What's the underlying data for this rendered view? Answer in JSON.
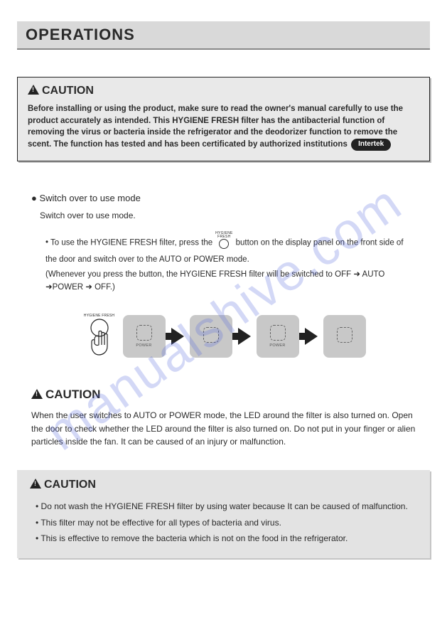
{
  "watermark": "manualshive.com",
  "page_title": "OPERATIONS",
  "caution1": {
    "heading": "CAUTION",
    "body_before_badge": "Before installing or using the product, make sure to read the owner's manual carefully to use the product accurately as intended. This HYGIENE FRESH filter has the antibacterial function of removing the virus or bacteria inside the refrigerator and the deodorizer function to remove the scent.\nThe function has tested and has been certificated by authorized institutions",
    "badge": "Intertek"
  },
  "mode_section": {
    "bullet_heading": "Switch over to use mode",
    "sub_text": "Switch over to use mode.",
    "btn_label": "HYGIENE FRESH",
    "line1_before": "To use the HYGIENE FRESH filter, press the",
    "line1_after": "button on the display panel on the front side of the door and switch over to the AUTO or POWER mode.",
    "paren": "(Whenever you press the button, the HYGIENE FRESH filter will be switched to OFF ➜ AUTO ➜POWER ➜ OFF.)"
  },
  "diagram": {
    "hand_label": "HYGIENE FRESH",
    "panels": [
      "POWER",
      "",
      "POWER",
      ""
    ]
  },
  "caution2": {
    "heading": "CAUTION",
    "body": "When the user switches to AUTO or POWER mode, the LED around the filter is also turned on. Open the door to check whether the LED around the filter is also turned on. Do not put in your finger or alien particles inside the fan. It can be caused of an injury or malfunction."
  },
  "caution3": {
    "heading": "CAUTION",
    "items": [
      "Do not wash the HYGIENE FRESH filter by using water because It can be caused of malfunction.",
      "This filter may not be effective for all types of bacteria and virus.",
      "This is effective to remove the bacteria which is not on the food in the refrigerator."
    ]
  }
}
